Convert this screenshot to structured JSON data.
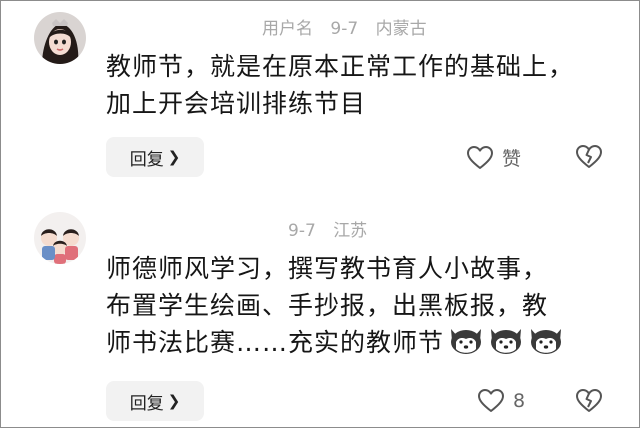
{
  "comments": [
    {
      "username": "用户名",
      "date": "9-7",
      "location": "内蒙古",
      "text_lines": [
        "教师节，就是在原本正常工作的基础上，",
        "加上开会培训排练节目"
      ],
      "reply_label": "回复",
      "like_label": "赞",
      "like_icon": "heart-icon",
      "dislike_icon": "broken-heart-icon"
    },
    {
      "date": "9-7",
      "location": "江苏",
      "text_lines": [
        "师德师风学习，撰写教书育人小故事，",
        "布置学生绘画、手抄报，出黑板报，教",
        "师书法比赛……充实的教师节"
      ],
      "emoji_icons": [
        "husky-emoji-icon",
        "husky-emoji-icon",
        "husky-emoji-icon"
      ],
      "reply_label": "回复",
      "like_count": "8",
      "like_icon": "heart-icon",
      "dislike_icon": "broken-heart-icon"
    }
  ],
  "colors": {
    "meta_text": "#a8a8a8",
    "button_bg": "#f2f2f2",
    "body_text": "#161616"
  }
}
